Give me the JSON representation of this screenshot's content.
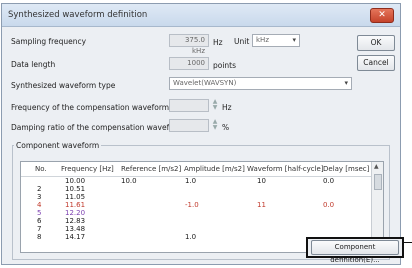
{
  "window": {
    "title": "Synthesized waveform definition",
    "close_glyph": "✕"
  },
  "form": {
    "sampling_frequency": {
      "label": "Sampling frequency",
      "value": "375.0 kHz",
      "unit_prefix": "Hz",
      "unit_label": "Unit",
      "unit_value": "kHz"
    },
    "data_length": {
      "label": "Data length",
      "value": "1000",
      "suffix": "points"
    },
    "synthesized_waveform_type": {
      "label": "Synthesized waveform type",
      "value": "Wavelet(WAVSYN)"
    },
    "compensation_frequency": {
      "label": "Frequency of the compensation waveform",
      "value": "",
      "unit": "Hz"
    },
    "compensation_damping": {
      "label": "Damping ratio of the compensation waveform",
      "value": "",
      "unit": "%"
    }
  },
  "buttons": {
    "ok": "OK",
    "cancel": "Cancel",
    "component_definition": "Component definition(E)..."
  },
  "component_group": {
    "label": "Component waveform",
    "columns": [
      "No.",
      "Frequency [Hz]",
      "Reference [m/s2]",
      "Amplitude [m/s2]",
      "Waveform [half-cycle]",
      "Delay [msec]"
    ],
    "rows": [
      {
        "no": "",
        "freq": "10.00",
        "ref": "10.0",
        "amp": "1.0",
        "wave": "10",
        "delay": "0.0",
        "color": "#1a1a1a"
      },
      {
        "no": "2",
        "freq": "10.51",
        "ref": "",
        "amp": "",
        "wave": "",
        "delay": "",
        "color": "#1a1a1a"
      },
      {
        "no": "3",
        "freq": "11.05",
        "ref": "",
        "amp": "",
        "wave": "",
        "delay": "",
        "color": "#1a1a1a"
      },
      {
        "no": "4",
        "freq": "11.61",
        "ref": "",
        "amp": "-1.0",
        "wave": "11",
        "delay": "0.0",
        "color": "#c0392b"
      },
      {
        "no": "5",
        "freq": "12.20",
        "ref": "",
        "amp": "",
        "wave": "",
        "delay": "",
        "color": "#7b3fb0"
      },
      {
        "no": "6",
        "freq": "12.83",
        "ref": "",
        "amp": "",
        "wave": "",
        "delay": "",
        "color": "#1a1a1a"
      },
      {
        "no": "7",
        "freq": "13.48",
        "ref": "",
        "amp": "",
        "wave": "",
        "delay": "",
        "color": "#1a1a1a"
      },
      {
        "no": "8",
        "freq": "14.17",
        "ref": "",
        "amp": "1.0",
        "wave": "",
        "delay": "",
        "color": "#1a1a1a"
      }
    ]
  }
}
